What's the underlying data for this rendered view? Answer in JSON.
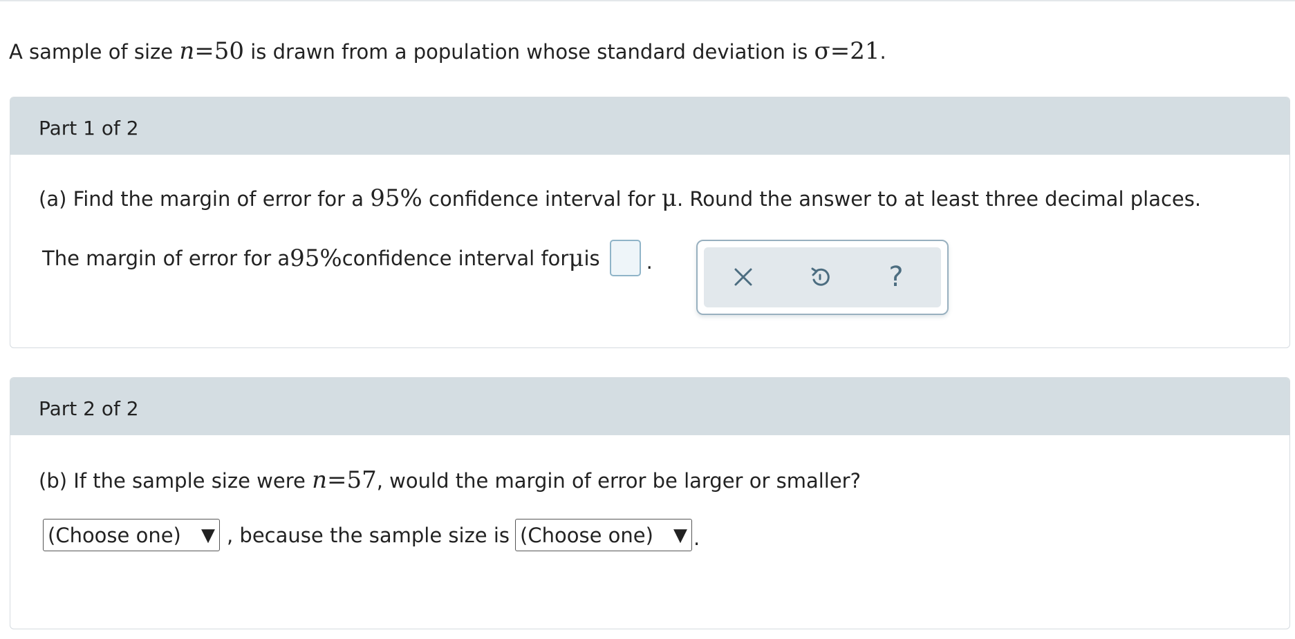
{
  "intro": {
    "prefix": "A sample of size ",
    "n_symbol": "n",
    "n_value": "=50",
    "middle": " is drawn from a population whose standard deviation is ",
    "sigma_expr": "σ=21",
    "suffix": "."
  },
  "part1": {
    "header": "Part 1 of 2",
    "question": {
      "prefix": "(a) Find the margin of error for a ",
      "pct": "95%",
      "middle": " confidence interval for ",
      "mu": "μ",
      "suffix": ". Round the answer to at least three decimal places."
    },
    "answer": {
      "prefix": "The margin of error for a ",
      "pct": "95%",
      "middle": " confidence interval for ",
      "mu": "μ",
      "suffix": " is",
      "input_value": "",
      "period": "."
    },
    "tools": {
      "close_icon": "close-icon",
      "undo_icon": "undo-icon",
      "help_icon": "help-icon",
      "help_glyph": "?"
    }
  },
  "part2": {
    "header": "Part 2 of 2",
    "question": {
      "prefix": "(b) If the sample size were ",
      "n_symbol": "n",
      "n_value": "=57",
      "suffix": ", would the margin of error be larger or smaller?"
    },
    "answer": {
      "select1": "(Choose one)",
      "middle": ", because the sample size is",
      "select2": "(Choose one)",
      "arrow": "▼",
      "period": "."
    }
  },
  "colors": {
    "header_bg": "#d4dde2",
    "card_border": "#d5dbe0",
    "input_border": "#8fb4c8",
    "input_fill": "#eef5f9",
    "tool_icon": "#4c6d80"
  }
}
